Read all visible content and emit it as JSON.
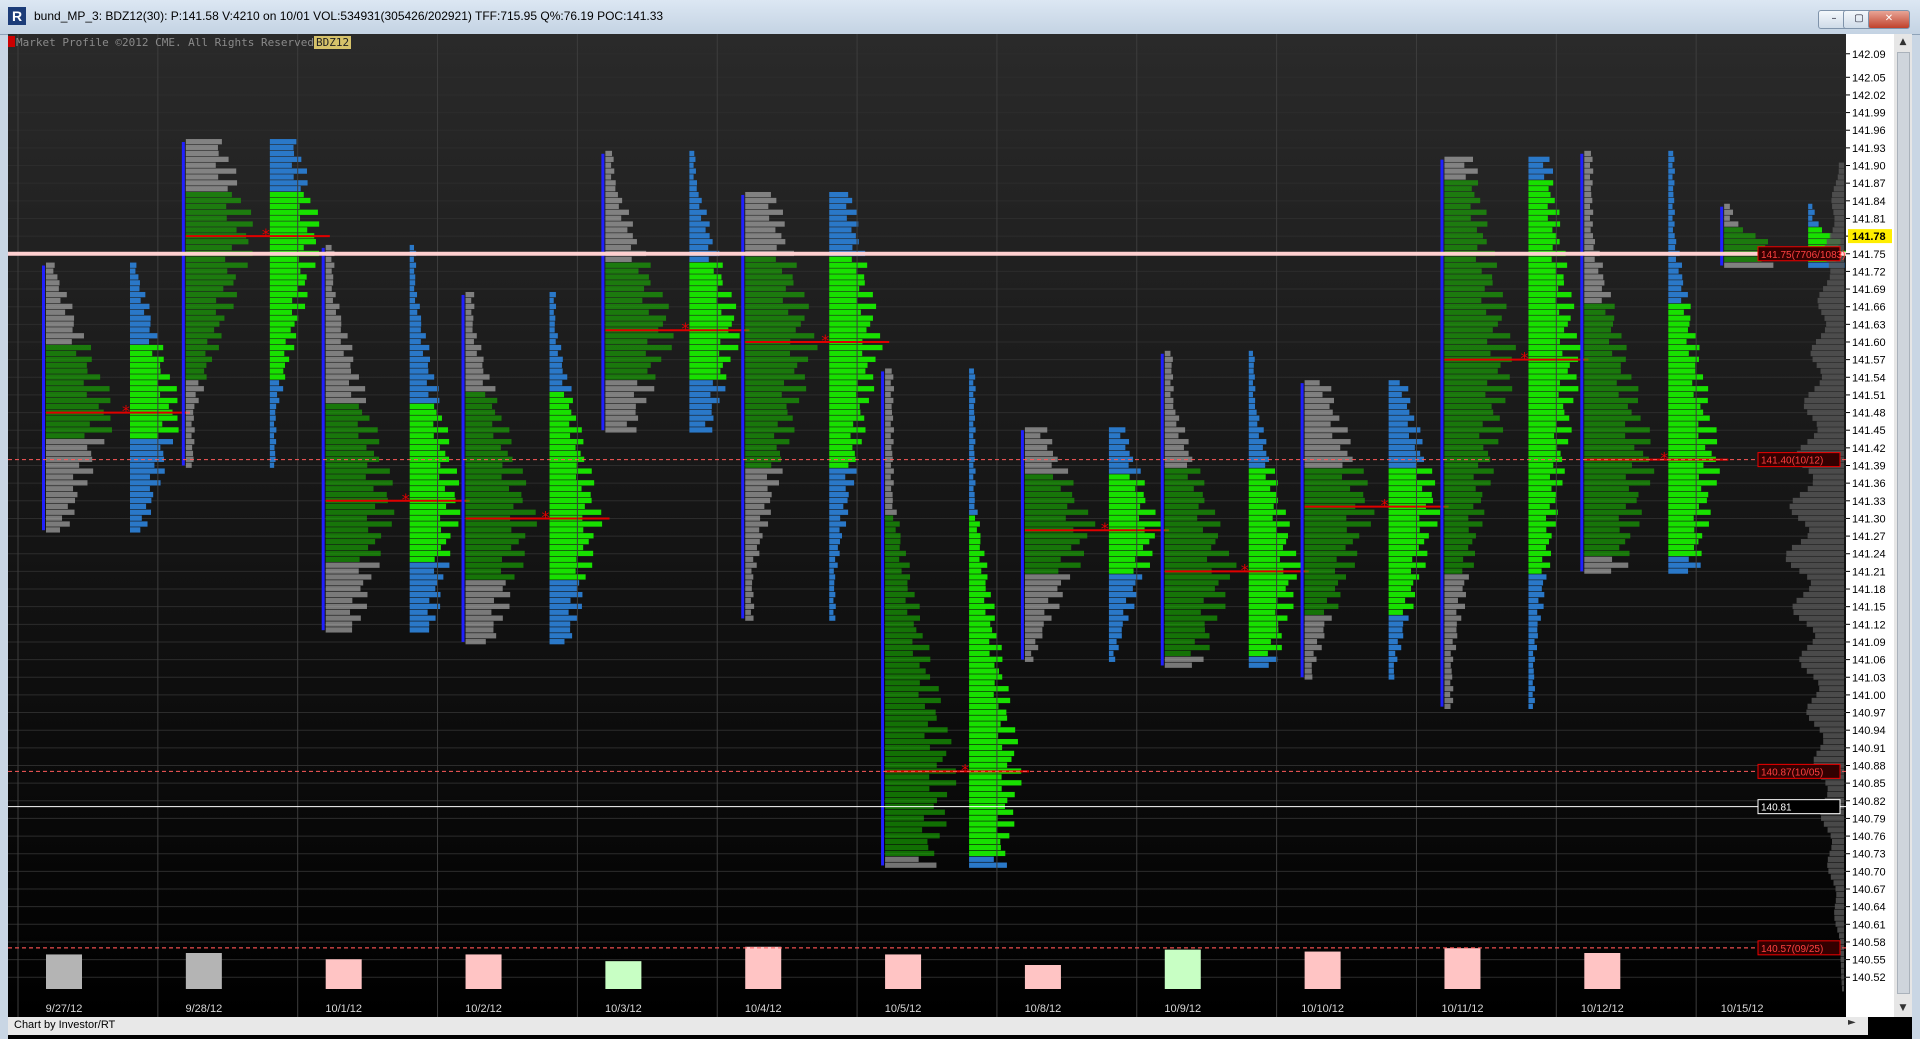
{
  "window": {
    "title": "bund_MP_3: BDZ12(30): P:141.58 V:4210 on 10/01 VOL:534931(305426/202921) TFF:715.95 Q%:76.19 POC:141.33",
    "icon": "R",
    "buttons": [
      "–",
      "▢",
      "✕"
    ]
  },
  "chart": {
    "copyright": "Market Profile ©2012 CME. All Rights Reserved",
    "symbol": "BDZ12",
    "credit": "Chart by Investor/RT",
    "colors": {
      "value_area": "#18e000",
      "profile_outside": "#2a78c8",
      "letters_in": "#19c400",
      "letters_out": "#cfcfcf",
      "ib_bar": "#2020ff",
      "poc": "#e00000",
      "price_line": "#ff5a5a",
      "price_label_bg": "#ffee00"
    }
  },
  "chart_data": {
    "type": "market-profile",
    "price_axis": {
      "ticks": [
        "142.09",
        "142.05",
        "142.02",
        "141.99",
        "141.96",
        "141.93",
        "141.90",
        "141.87",
        "141.84",
        "141.81",
        "141.78",
        "141.75",
        "141.72",
        "141.69",
        "141.66",
        "141.63",
        "141.60",
        "141.57",
        "141.54",
        "141.51",
        "141.48",
        "141.45",
        "141.42",
        "141.39",
        "141.36",
        "141.33",
        "141.30",
        "141.27",
        "141.24",
        "141.21",
        "141.18",
        "141.15",
        "141.12",
        "141.09",
        "141.06",
        "141.03",
        "141.00",
        "140.97",
        "140.94",
        "140.91",
        "140.88",
        "140.85",
        "140.82",
        "140.79",
        "140.76",
        "140.73",
        "140.70",
        "140.67",
        "140.64",
        "140.61",
        "140.58",
        "140.55",
        "140.52"
      ],
      "range": [
        140.5,
        142.11
      ]
    },
    "sessions": [
      {
        "date": "9/27/12",
        "high": 141.73,
        "low": 141.28,
        "va_high": 141.59,
        "va_low": 141.44,
        "poc": 141.48,
        "volume_color": "gray",
        "volume": 0.72
      },
      {
        "date": "9/28/12",
        "high": 141.94,
        "low": 141.39,
        "va_high": 141.85,
        "va_low": 141.54,
        "poc": 141.78,
        "volume_color": "gray",
        "volume": 0.75
      },
      {
        "date": "10/1/12",
        "high": 141.76,
        "low": 141.11,
        "va_high": 141.49,
        "va_low": 141.23,
        "poc": 141.33,
        "volume_color": "pink",
        "volume": 0.62
      },
      {
        "date": "10/2/12",
        "high": 141.68,
        "low": 141.09,
        "va_high": 141.51,
        "va_low": 141.2,
        "poc": 141.3,
        "volume_color": "pink",
        "volume": 0.72
      },
      {
        "date": "10/3/12",
        "high": 141.92,
        "low": 141.45,
        "va_high": 141.73,
        "va_low": 141.54,
        "poc": 141.62,
        "volume_color": "green",
        "volume": 0.58
      },
      {
        "date": "10/4/12",
        "high": 141.85,
        "low": 141.13,
        "va_high": 141.74,
        "va_low": 141.39,
        "poc": 141.6,
        "volume_color": "pink",
        "volume": 0.88
      },
      {
        "date": "10/5/12",
        "high": 141.55,
        "low": 140.71,
        "va_high": 141.3,
        "va_low": 140.73,
        "poc": 140.87,
        "volume_color": "pink",
        "volume": 0.72
      },
      {
        "date": "10/8/12",
        "high": 141.45,
        "low": 141.06,
        "va_high": 141.37,
        "va_low": 141.21,
        "poc": 141.28,
        "volume_color": "pink",
        "volume": 0.5
      },
      {
        "date": "10/9/12",
        "high": 141.58,
        "low": 141.05,
        "va_high": 141.38,
        "va_low": 141.07,
        "poc": 141.21,
        "volume_color": "green",
        "volume": 0.82
      },
      {
        "date": "10/10/12",
        "high": 141.53,
        "low": 141.03,
        "va_high": 141.38,
        "va_low": 141.14,
        "poc": 141.32,
        "volume_color": "pink",
        "volume": 0.78
      },
      {
        "date": "10/11/12",
        "high": 141.91,
        "low": 140.98,
        "va_high": 141.87,
        "va_low": 141.21,
        "poc": 141.57,
        "volume_color": "pink",
        "volume": 0.85
      },
      {
        "date": "10/12/12",
        "high": 141.92,
        "low": 141.21,
        "va_high": 141.66,
        "va_low": 141.24,
        "poc": 141.4,
        "volume_color": "pink",
        "volume": 0.75
      },
      {
        "date": "10/15/12",
        "high": 141.83,
        "low": 141.73,
        "va_high": 141.79,
        "va_low": 141.74,
        "poc": 141.75,
        "volume_color": "none",
        "volume": 0
      }
    ],
    "reference_lines": [
      {
        "price": 141.75,
        "label": "141.75(7706/1083)",
        "style": "current"
      },
      {
        "price": 141.4,
        "label": "141.40(10/12)",
        "style": "naked-poc"
      },
      {
        "price": 140.87,
        "label": "140.87(10/05)",
        "style": "naked-poc"
      },
      {
        "price": 140.81,
        "label": "140.81",
        "style": "marker"
      },
      {
        "price": 140.57,
        "label": "140.57(09/25)",
        "style": "naked-poc"
      }
    ],
    "last_price": {
      "price": 141.78,
      "label": "141.78"
    }
  },
  "scrollbar": {
    "up": "▲",
    "down": "▼",
    "left": "◄",
    "right": "►"
  }
}
